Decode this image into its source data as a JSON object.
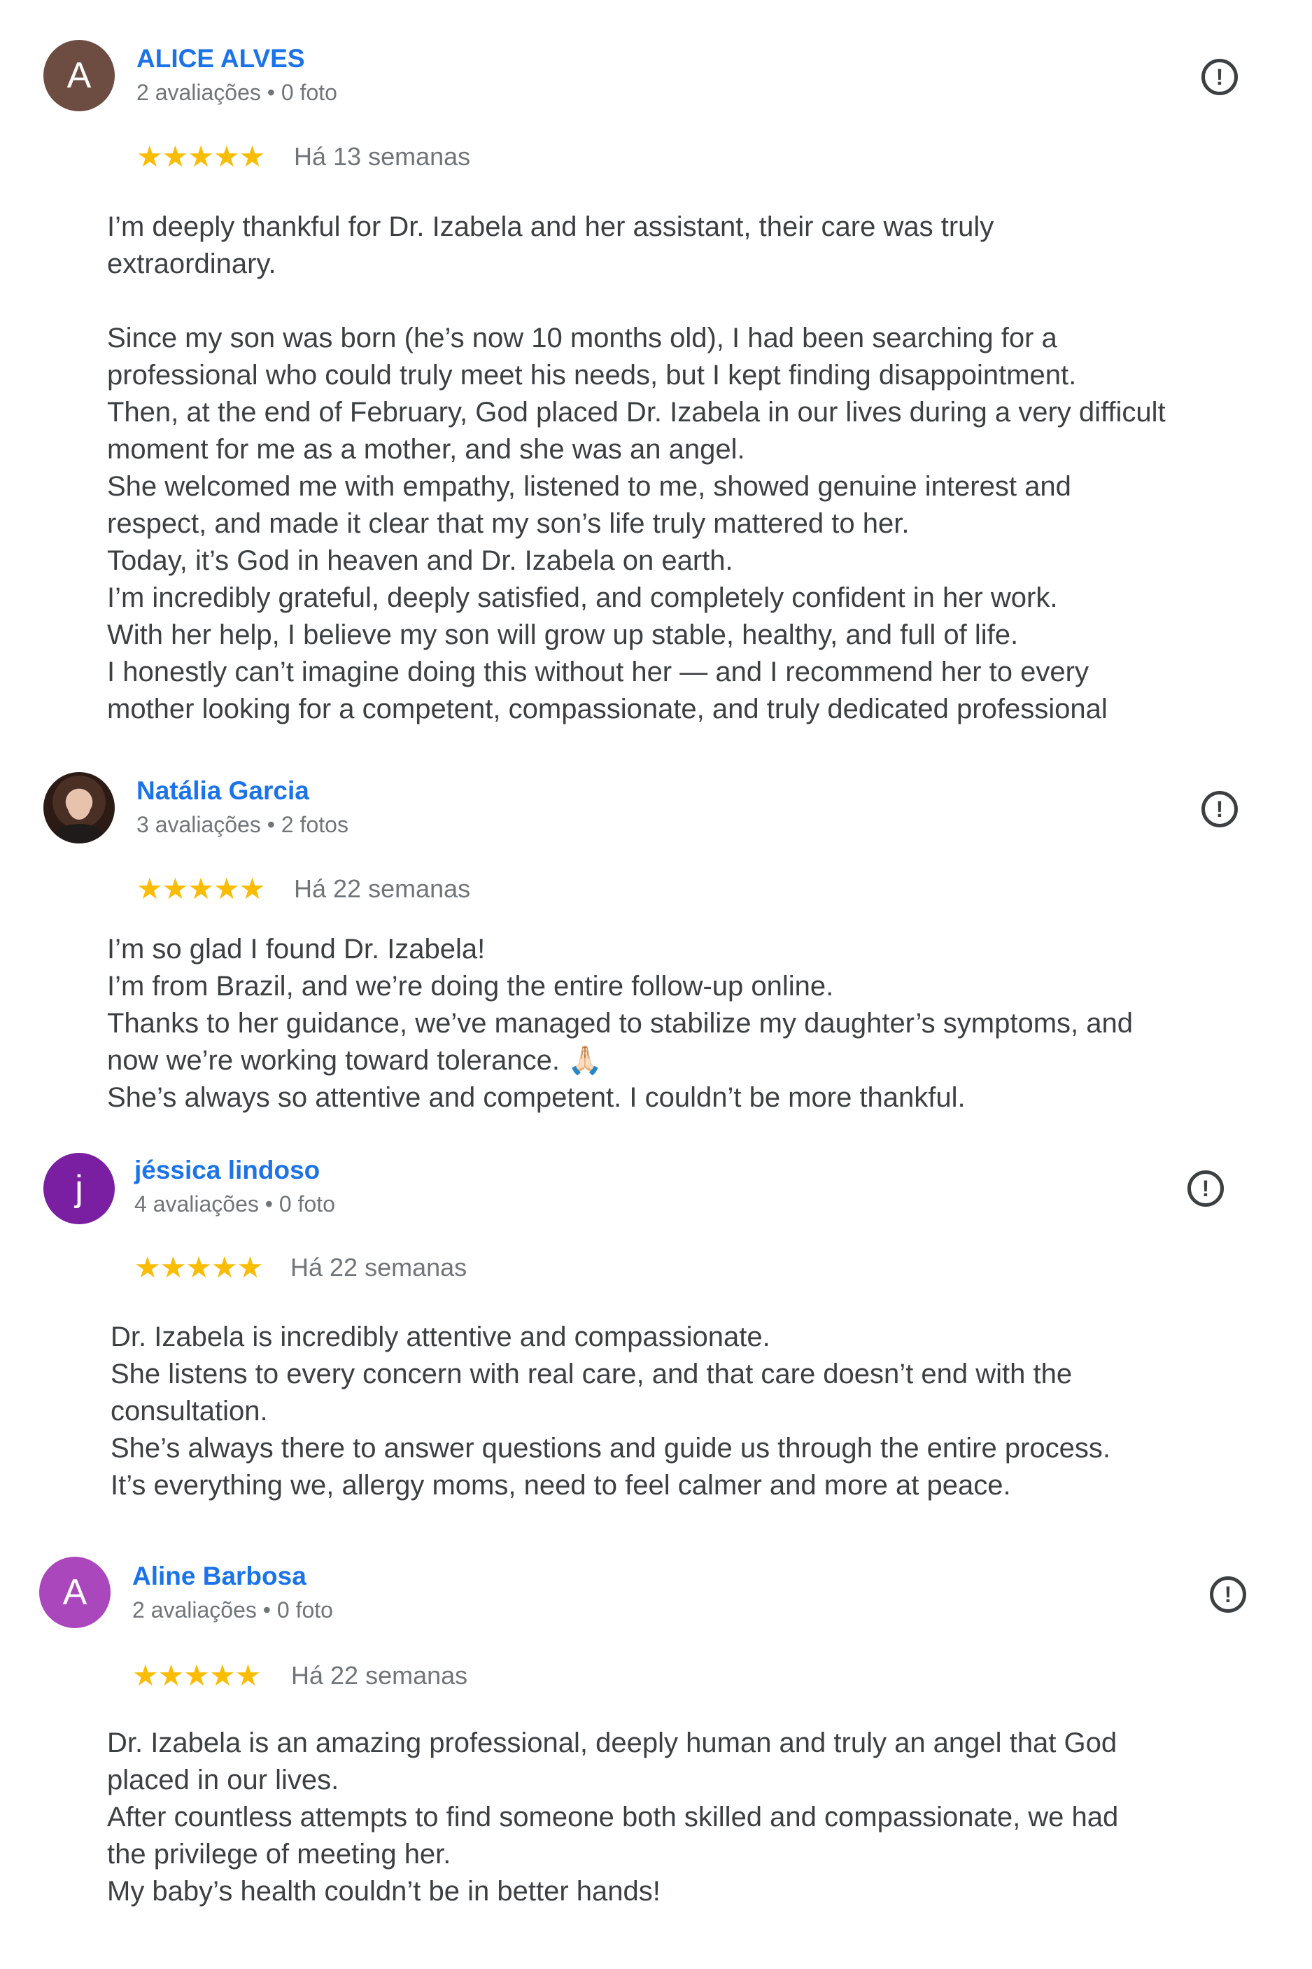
{
  "reviews": [
    {
      "avatar_letter": "A",
      "avatar_color": "#6d4c41",
      "name": "ALICE ALVES",
      "meta": "2 avaliações • 0 foto",
      "stars": "★★★★★",
      "date": "Há 13 semanas",
      "body": "I’m deeply thankful for Dr. Izabela and her assistant, their care was truly\nextraordinary.\n\nSince my son was born (he’s now 10 months old), I had been searching for a\nprofessional who could truly meet his needs, but I kept finding disappointment.\nThen, at the end of February, God placed Dr. Izabela in our lives during a very difficult\nmoment for me as a mother, and she was an angel.\nShe welcomed me with empathy, listened to me, showed genuine interest and\nrespect, and made it clear that my son’s life truly mattered to her.\nToday, it’s God in heaven and Dr. Izabela on earth.\nI’m incredibly grateful, deeply satisfied, and completely confident in her work.\nWith her help, I believe my son will grow up stable, healthy, and full of life.\nI honestly can’t imagine doing this without her — and I recommend her to every\nmother looking for a competent, compassionate, and truly dedicated professional"
    },
    {
      "avatar_letter": "",
      "avatar_color": "#3b2a22",
      "name": "Natália Garcia",
      "meta": "3 avaliações • 2 fotos",
      "stars": "★★★★★",
      "date": "Há 22 semanas",
      "body": "I’m so glad I found Dr. Izabela!\nI’m from Brazil, and we’re doing the entire follow-up online.\nThanks to her guidance, we’ve managed to stabilize my daughter’s symptoms, and\nnow we’re working toward tolerance. 🙏🏻\nShe’s always so attentive and competent. I couldn’t be more thankful."
    },
    {
      "avatar_letter": "j",
      "avatar_color": "#7b1fa2",
      "name": "jéssica lindoso",
      "meta": "4 avaliações • 0 foto",
      "stars": "★★★★★",
      "date": "Há 22 semanas",
      "body": "Dr. Izabela is incredibly attentive and compassionate.\nShe listens to every concern with real care, and that care doesn’t end with the\nconsultation.\nShe’s always there to answer questions and guide us through the entire process.\nIt’s everything we, allergy moms, need to feel calmer and more at peace."
    },
    {
      "avatar_letter": "A",
      "avatar_color": "#ab47bc",
      "name": "Aline Barbosa",
      "meta": "2 avaliações • 0 foto",
      "stars": "★★★★★",
      "date": "Há 22 semanas",
      "body": "Dr. Izabela is an amazing professional, deeply human and truly an angel that God\nplaced in our lives.\nAfter countless attempts to find someone both skilled and compassionate, we had\nthe privilege of meeting her.\nMy baby’s health couldn’t be in better hands!"
    }
  ],
  "flag_glyph": "!",
  "flag_icon": "report-flag-icon"
}
